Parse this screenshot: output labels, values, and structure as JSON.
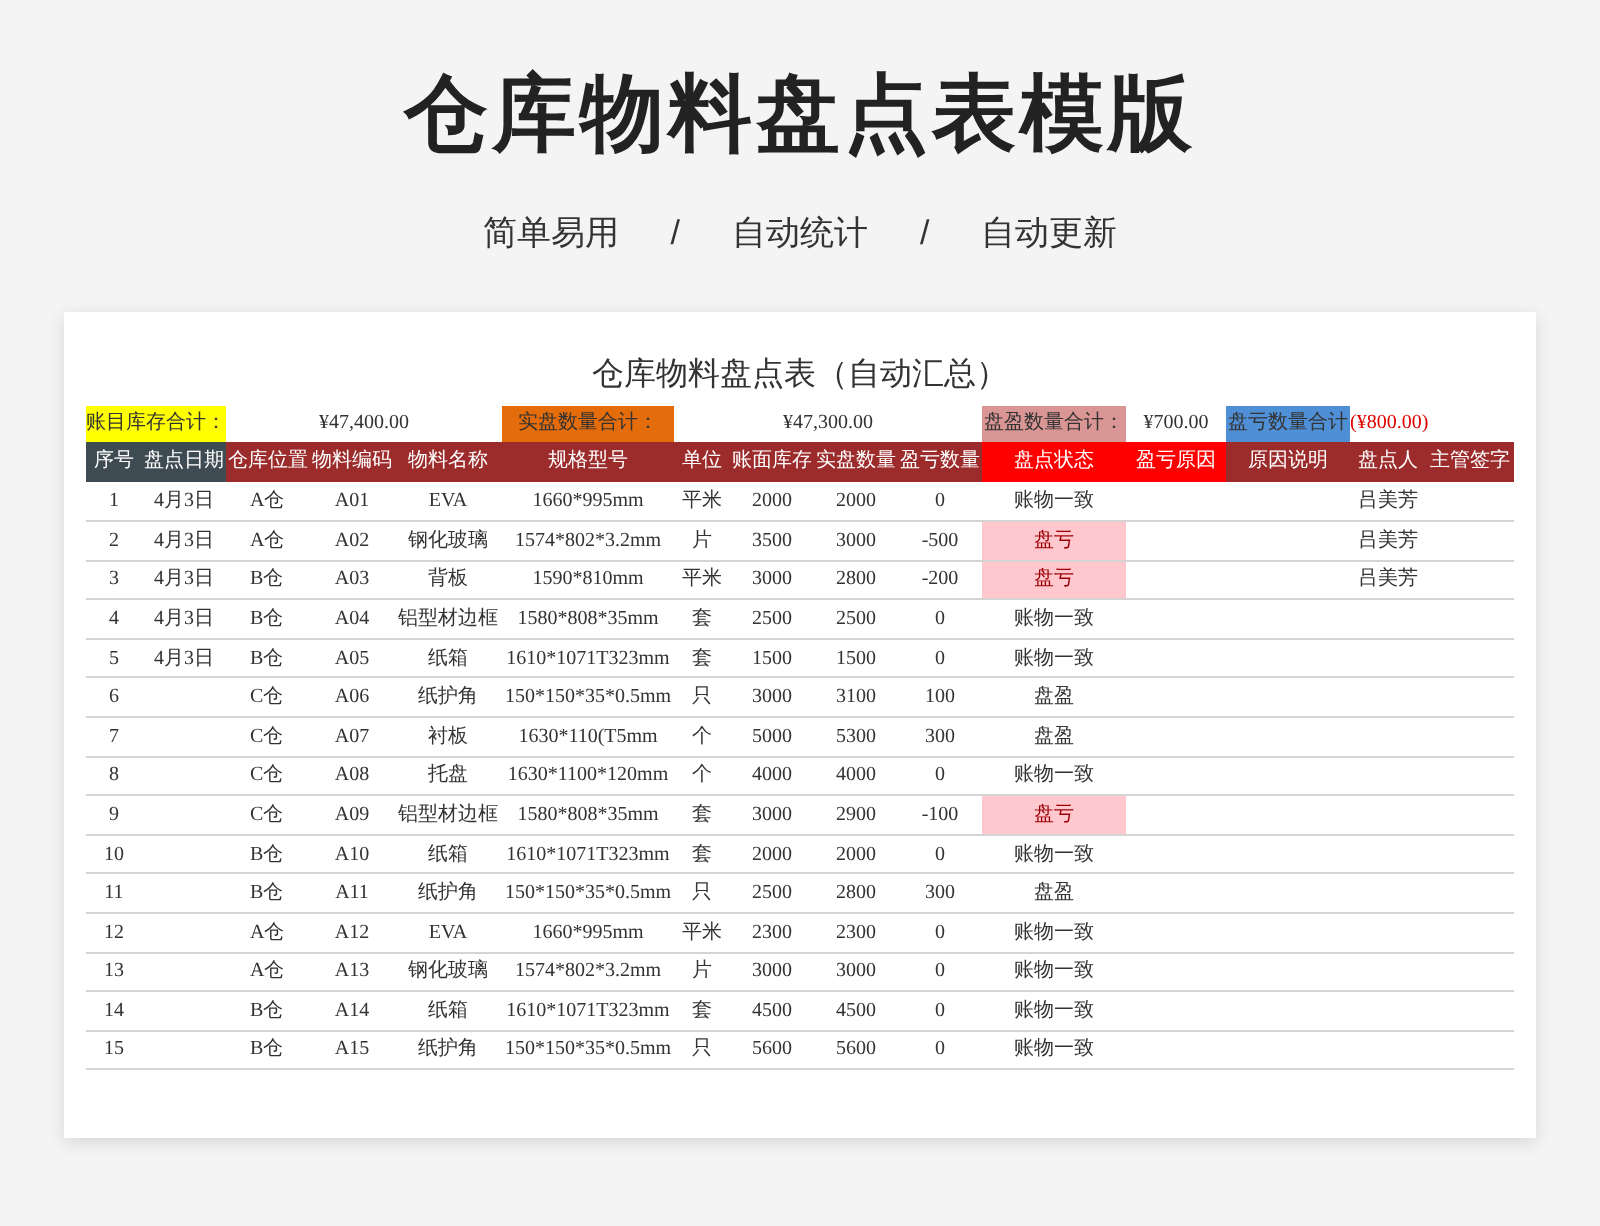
{
  "title": "仓库物料盘点表模版",
  "features": [
    "简单易用",
    "自动统计",
    "自动更新"
  ],
  "separators": [
    "/",
    "/"
  ],
  "sheet": {
    "title": "仓库物料盘点表（自动汇总）",
    "summary": [
      {
        "label": "账目库存合计：",
        "color": "#ffff00",
        "value": "¥47,400.00",
        "negative": false
      },
      {
        "label": "实盘数量合计：",
        "color": "#e46c0a",
        "value": "¥47,300.00",
        "negative": false
      },
      {
        "label": "盘盈数量合计：",
        "color": "#d99694",
        "value": "¥700.00",
        "negative": false
      },
      {
        "label": "盘亏数量合计",
        "color": "#4f8fd6",
        "value": "(¥800.00)",
        "negative": true
      }
    ],
    "columns": [
      {
        "label": "序号",
        "color": "#3f4b52"
      },
      {
        "label": "盘点日期",
        "color": "#3f4b52"
      },
      {
        "label": "仓库位置",
        "color": "#9c2b2b"
      },
      {
        "label": "物料编码",
        "color": "#9c2b2b"
      },
      {
        "label": "物料名称",
        "color": "#9c2b2b"
      },
      {
        "label": "规格型号",
        "color": "#9c2b2b"
      },
      {
        "label": "单位",
        "color": "#9c2b2b"
      },
      {
        "label": "账面库存",
        "color": "#9c2b2b"
      },
      {
        "label": "实盘数量",
        "color": "#9c2b2b"
      },
      {
        "label": "盈亏数量",
        "color": "#9c2b2b"
      },
      {
        "label": "盘点状态",
        "color": "#ff0000"
      },
      {
        "label": "盈亏原因",
        "color": "#ff0000"
      },
      {
        "label": "原因说明",
        "color": "#9c2b2b"
      },
      {
        "label": "盘点人",
        "color": "#9c2b2b"
      },
      {
        "label": "主管签字",
        "color": "#9c2b2b"
      }
    ],
    "rows": [
      {
        "no": "1",
        "date": "4月3日",
        "location": "A仓",
        "code": "A01",
        "name": "EVA",
        "spec": "1660*995mm",
        "unit": "平米",
        "book": "2000",
        "actual": "2000",
        "diff": "0",
        "status": "账物一致",
        "highlighted": false,
        "counter": "吕美芳"
      },
      {
        "no": "2",
        "date": "4月3日",
        "location": "A仓",
        "code": "A02",
        "name": "钢化玻璃",
        "spec": "1574*802*3.2mm",
        "unit": "片",
        "book": "3500",
        "actual": "3000",
        "diff": "-500",
        "status": "盘亏",
        "highlighted": true,
        "counter": "吕美芳"
      },
      {
        "no": "3",
        "date": "4月3日",
        "location": "B仓",
        "code": "A03",
        "name": "背板",
        "spec": "1590*810mm",
        "unit": "平米",
        "book": "3000",
        "actual": "2800",
        "diff": "-200",
        "status": "盘亏",
        "highlighted": true,
        "counter": "吕美芳"
      },
      {
        "no": "4",
        "date": "4月3日",
        "location": "B仓",
        "code": "A04",
        "name": "铝型材边框",
        "spec": "1580*808*35mm",
        "unit": "套",
        "book": "2500",
        "actual": "2500",
        "diff": "0",
        "status": "账物一致",
        "highlighted": false
      },
      {
        "no": "5",
        "date": "4月3日",
        "location": "B仓",
        "code": "A05",
        "name": "纸箱",
        "spec": "1610*1071T323mm",
        "unit": "套",
        "book": "1500",
        "actual": "1500",
        "diff": "0",
        "status": "账物一致",
        "highlighted": false
      },
      {
        "no": "6",
        "location": "C仓",
        "code": "A06",
        "name": "纸护角",
        "spec": "150*150*35*0.5mm",
        "unit": "只",
        "book": "3000",
        "actual": "3100",
        "diff": "100",
        "status": "盘盈",
        "highlighted": false
      },
      {
        "no": "7",
        "location": "C仓",
        "code": "A07",
        "name": "衬板",
        "spec": "1630*110(T5mm",
        "unit": "个",
        "book": "5000",
        "actual": "5300",
        "diff": "300",
        "status": "盘盈",
        "highlighted": false
      },
      {
        "no": "8",
        "location": "C仓",
        "code": "A08",
        "name": "托盘",
        "spec": "1630*1100*120mm",
        "unit": "个",
        "book": "4000",
        "actual": "4000",
        "diff": "0",
        "status": "账物一致",
        "highlighted": false
      },
      {
        "no": "9",
        "location": "C仓",
        "code": "A09",
        "name": "铝型材边框",
        "spec": "1580*808*35mm",
        "unit": "套",
        "book": "3000",
        "actual": "2900",
        "diff": "-100",
        "status": "盘亏",
        "highlighted": true
      },
      {
        "no": "10",
        "location": "B仓",
        "code": "A10",
        "name": "纸箱",
        "spec": "1610*1071T323mm",
        "unit": "套",
        "book": "2000",
        "actual": "2000",
        "diff": "0",
        "status": "账物一致",
        "highlighted": false
      },
      {
        "no": "11",
        "location": "B仓",
        "code": "A11",
        "name": "纸护角",
        "spec": "150*150*35*0.5mm",
        "unit": "只",
        "book": "2500",
        "actual": "2800",
        "diff": "300",
        "status": "盘盈",
        "highlighted": false
      },
      {
        "no": "12",
        "location": "A仓",
        "code": "A12",
        "name": "EVA",
        "spec": "1660*995mm",
        "unit": "平米",
        "book": "2300",
        "actual": "2300",
        "diff": "0",
        "status": "账物一致",
        "highlighted": false
      },
      {
        "no": "13",
        "location": "A仓",
        "code": "A13",
        "name": "钢化玻璃",
        "spec": "1574*802*3.2mm",
        "unit": "片",
        "book": "3000",
        "actual": "3000",
        "diff": "0",
        "status": "账物一致",
        "highlighted": false
      },
      {
        "no": "14",
        "location": "B仓",
        "code": "A14",
        "name": "纸箱",
        "spec": "1610*1071T323mm",
        "unit": "套",
        "book": "4500",
        "actual": "4500",
        "diff": "0",
        "status": "账物一致",
        "highlighted": false
      },
      {
        "no": "15",
        "location": "B仓",
        "code": "A15",
        "name": "纸护角",
        "spec": "150*150*35*0.5mm",
        "unit": "只",
        "book": "5600",
        "actual": "5600",
        "diff": "0",
        "status": "账物一致",
        "highlighted": false
      }
    ]
  }
}
